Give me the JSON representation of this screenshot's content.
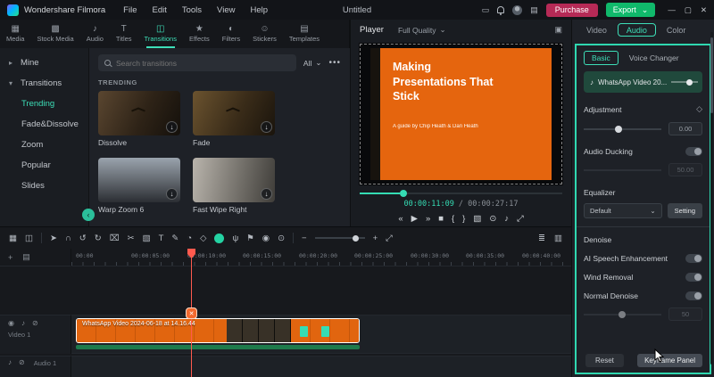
{
  "titlebar": {
    "app_name": "Wondershare Filmora",
    "menus": [
      "File",
      "Edit",
      "Tools",
      "View",
      "Help"
    ],
    "project_title": "Untitled",
    "purchase_label": "Purchase",
    "export_label": "Export"
  },
  "media_tabs": [
    {
      "label": "Media",
      "glyph": "▦"
    },
    {
      "label": "Stock Media",
      "glyph": "▩"
    },
    {
      "label": "Audio",
      "glyph": "♪"
    },
    {
      "label": "Titles",
      "glyph": "T"
    },
    {
      "label": "Transitions",
      "glyph": "◫"
    },
    {
      "label": "Effects",
      "glyph": "★"
    },
    {
      "label": "Filters",
      "glyph": "◐"
    },
    {
      "label": "Stickers",
      "glyph": "☺"
    },
    {
      "label": "Templates",
      "glyph": "▤"
    }
  ],
  "sidebar": {
    "groups": [
      {
        "label": "Mine",
        "chevron": "▸"
      },
      {
        "label": "Transitions",
        "chevron": "▾"
      }
    ],
    "items": [
      "Trending",
      "Fade&Dissolve",
      "Zoom",
      "Popular",
      "Slides"
    ],
    "active_item": "Trending"
  },
  "library": {
    "search_placeholder": "Search transitions",
    "filter_label": "All",
    "section_title": "TRENDING",
    "items": [
      {
        "name": "Dissolve"
      },
      {
        "name": "Fade"
      },
      {
        "name": "Warp Zoom 6"
      },
      {
        "name": "Fast Wipe Right"
      }
    ]
  },
  "player": {
    "title": "Player",
    "quality_label": "Full Quality",
    "slide": {
      "title": "Making Presentations That Stick",
      "subtitle": "A guide by Chip Heath & Dan Heath"
    },
    "current_time": "00:00:11:09",
    "separator": " / ",
    "total_time": "00:00:27:17",
    "progress_pct": 20
  },
  "properties": {
    "tabs": [
      "Video",
      "Audio",
      "Color"
    ],
    "active_tab": "Audio",
    "subtabs": [
      "Basic",
      "Voice Changer"
    ],
    "active_subtab": "Basic",
    "clip_name": "WhatsApp Video 20...",
    "adjustment_label": "Adjustment",
    "adjustment_value": "0.00",
    "audio_ducking_label": "Audio Ducking",
    "audio_ducking_value": "50.00",
    "equalizer_label": "Equalizer",
    "equalizer_preset": "Default",
    "setting_label": "Setting",
    "denoise_label": "Denoise",
    "ai_speech_label": "AI Speech Enhancement",
    "wind_removal_label": "Wind Removal",
    "normal_denoise_label": "Normal Denoise",
    "normal_denoise_value": "50",
    "reset_label": "Reset",
    "keyframe_label": "Keyframe Panel"
  },
  "timeline": {
    "ruler": [
      "00:00",
      "00:00:05:00",
      "00:00:10:00",
      "00:00:15:00",
      "00:00:20:00",
      "00:00:25:00",
      "00:00:30:00",
      "00:00:35:00",
      "00:00:40:00"
    ],
    "clip_label": "WhatsApp Video 2024-06-18 at 14.16.44",
    "tracks": [
      {
        "label": "Video 1"
      },
      {
        "label": "Audio 1"
      }
    ]
  },
  "colors": {
    "accent": "#35dcb4",
    "export_green": "#10b96b",
    "purchase_red": "#b62a56",
    "clip_orange": "#e1650f",
    "playhead_red": "#ff5a4e"
  },
  "icons": {
    "dropdown": "⌄",
    "more": "•••",
    "download": "↓",
    "collapse": "‹",
    "keyframe": "◇",
    "view": "▣",
    "skip_back": "«",
    "play": "▶",
    "skip_fwd": "»",
    "stop": "■",
    "mark_in": "{",
    "mark_out": "}",
    "crop": "▧",
    "snapshot": "⊙",
    "volume": "♪",
    "fullscreen": "⤢",
    "media_toggle": "▦",
    "audio_toggle": "◫",
    "pointer": "➤",
    "magnet": "∩",
    "undo": "↺",
    "redo": "↻",
    "trash": "⌧",
    "split": "✂",
    "text_tool": "T",
    "edit": "✎",
    "speed": "◔",
    "mic": "ψ",
    "marker": "⚑",
    "record": "◉",
    "zoom_out": "−",
    "zoom_in": "+",
    "fit": "⤢",
    "track_menu": "≣",
    "mixer": "▥",
    "add": "+",
    "layers": "▤",
    "eye": "◉",
    "mute": "♪",
    "lock": "⊘",
    "device": "▭",
    "minimize": "—",
    "maximize": "▢",
    "close": "✕"
  }
}
